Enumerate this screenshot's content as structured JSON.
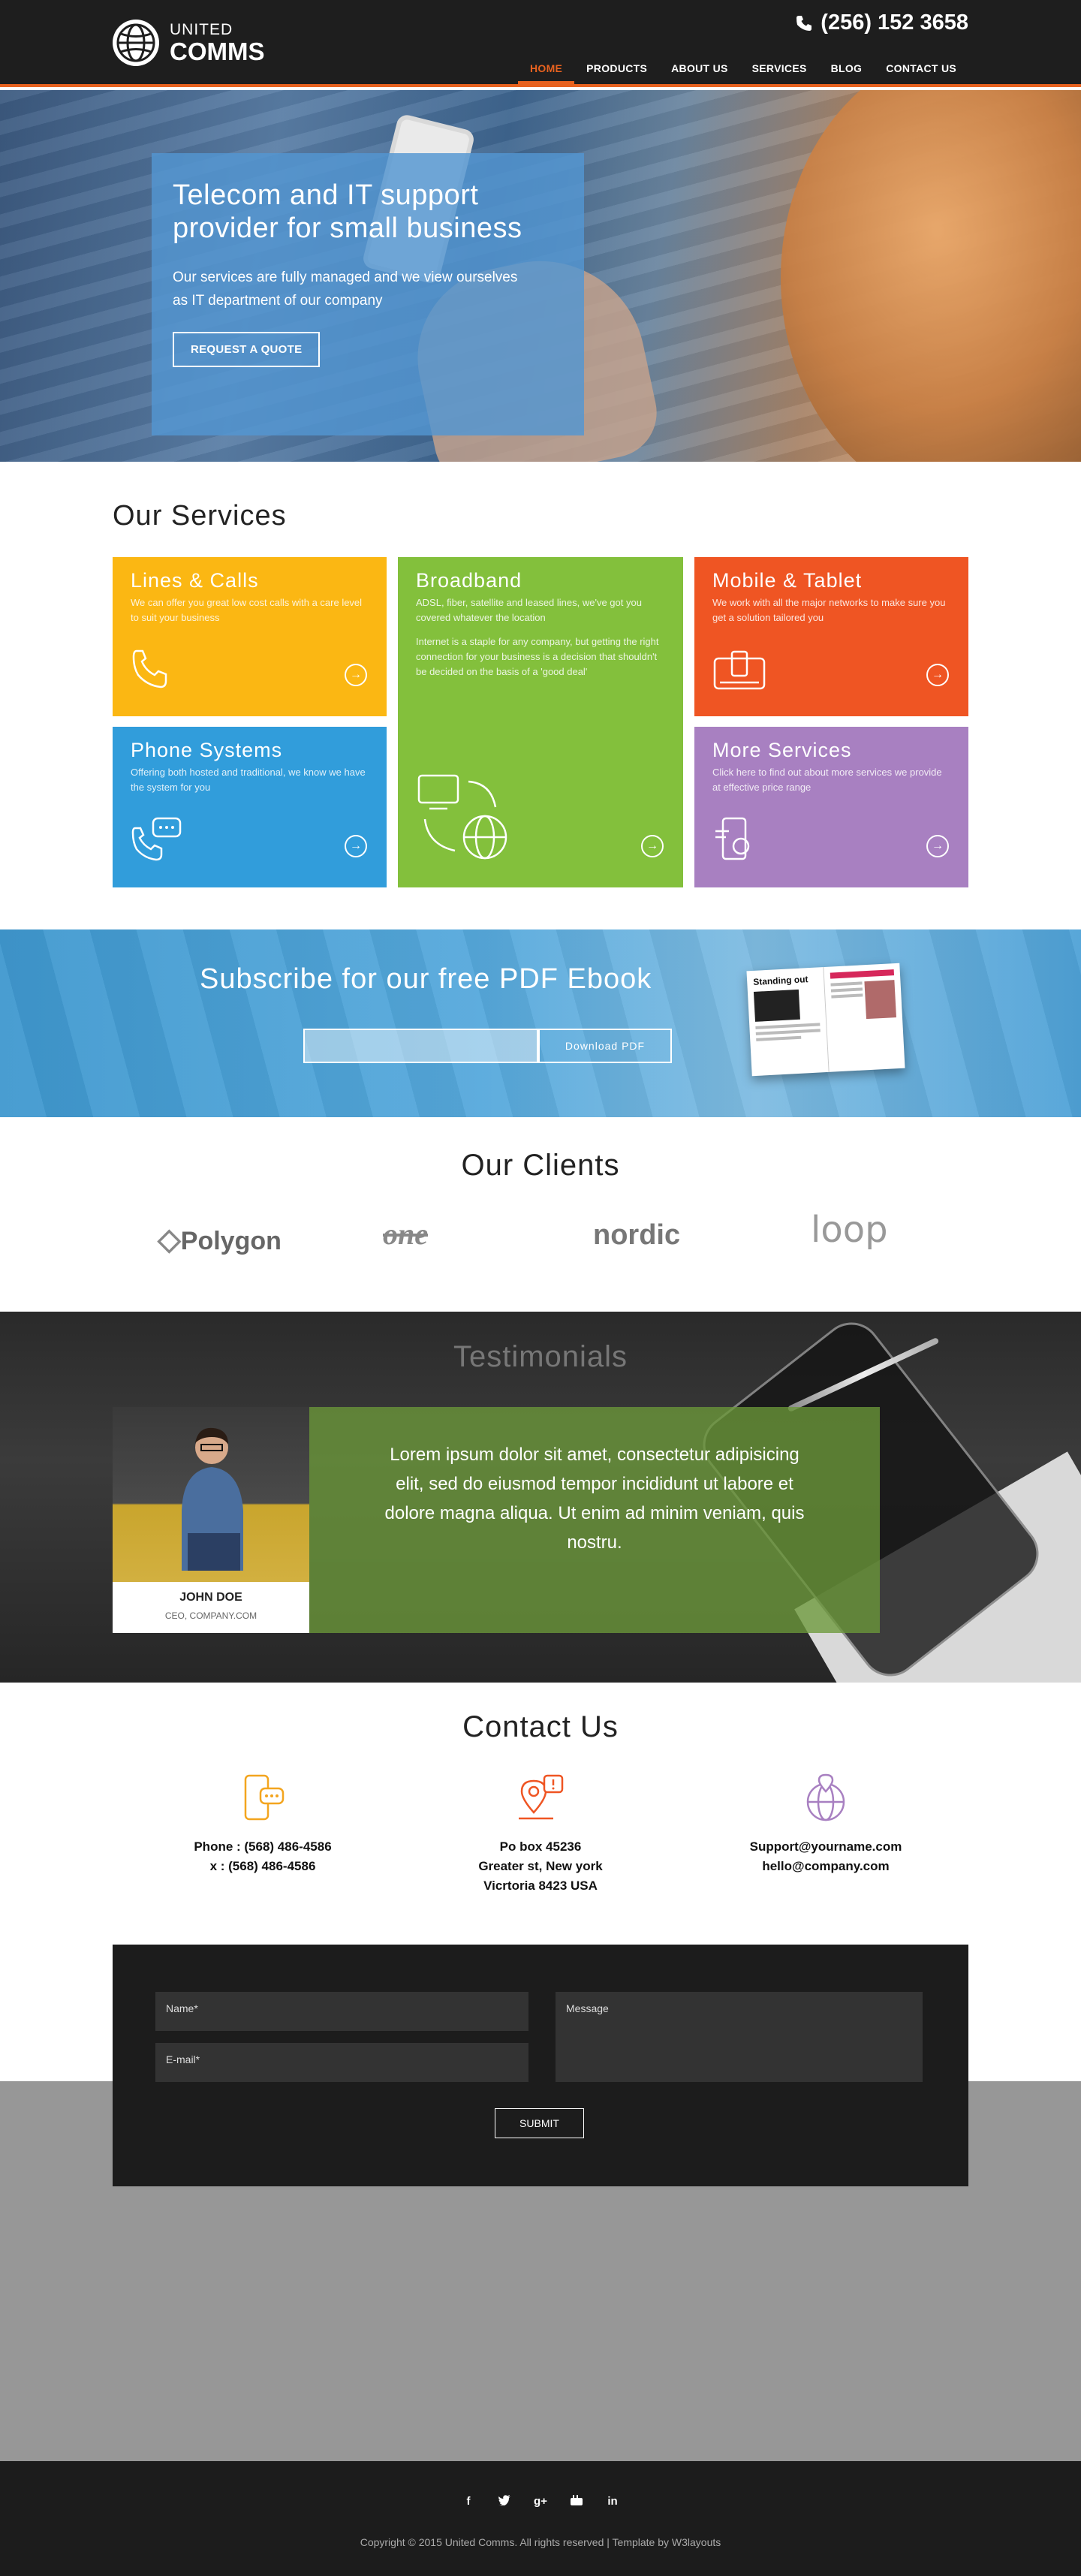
{
  "brand": {
    "small": "UNITED",
    "big": "COMMS"
  },
  "phone": "(256) 152 3658",
  "nav": [
    {
      "label": "HOME",
      "active": true
    },
    {
      "label": "PRODUCTS"
    },
    {
      "label": "ABOUT US"
    },
    {
      "label": "SERVICES"
    },
    {
      "label": "BLOG"
    },
    {
      "label": "CONTACT US"
    }
  ],
  "hero": {
    "title": "Telecom and IT support provider for small business",
    "text": "Our services are fully managed and we view ourselves as IT department of our company",
    "button": "REQUEST A QUOTE"
  },
  "services": {
    "title": "Our Services",
    "items": [
      {
        "title": "Lines & Calls",
        "text": "We can offer you great low cost calls with a care level to suit your business",
        "color": "#fbb713"
      },
      {
        "title": "Broadband",
        "text": "ADSL, fiber, satellite and leased lines, we've got you covered whatever the location",
        "text2": "Internet is a staple for any company, but getting the right connection for your business is a decision that shouldn't be decided on the basis of a 'good deal'",
        "color": "#83c03c"
      },
      {
        "title": "Mobile & Tablet",
        "text": "We work with all the major networks to make sure you get a solution tailored you",
        "color": "#ef5523"
      },
      {
        "title": "Phone Systems",
        "text": "Offering both hosted and traditional, we know we have the system for you",
        "color": "#319ddb"
      },
      {
        "title": "More Services",
        "text": "Click here to find out about more services we provide at effective price range",
        "color": "#a880c1"
      }
    ]
  },
  "subscribe": {
    "title": "Subscribe for our free PDF Ebook",
    "button": "Download PDF",
    "input_placeholder": "",
    "magazine_headline": "Standing out"
  },
  "clients": {
    "title": "Our Clients",
    "logos": [
      "Polygon",
      "one",
      "nordic",
      "loop"
    ]
  },
  "testimonials": {
    "title": "Testimonials",
    "quote": "Lorem ipsum dolor sit amet, consectetur adipisicing elit, sed do eiusmod tempor incididunt ut labore et dolore magna aliqua. Ut enim ad minim veniam, quis nostru.",
    "name": "JOHN DOE",
    "role": "CEO, COMPANY.COM"
  },
  "contact": {
    "title": "Contact Us",
    "phone_line1": "Phone : (568) 486-4586",
    "phone_line2": "x : (568) 486-4586",
    "address_line1": "Po box 45236",
    "address_line2": "Greater st, New york",
    "address_line3": "Vicrtoria 8423 USA",
    "email_line1": "Support@yourname.com",
    "email_line2": "hello@company.com",
    "form": {
      "name_placeholder": "Name*",
      "email_placeholder": "E-mail*",
      "message_placeholder": "Message",
      "submit": "SUBMIT"
    }
  },
  "footer": {
    "social": [
      "f",
      "t",
      "g+",
      "yt",
      "in"
    ],
    "copyright": "Copyright © 2015 United Comms. All rights reserved | Template by W3layouts"
  }
}
